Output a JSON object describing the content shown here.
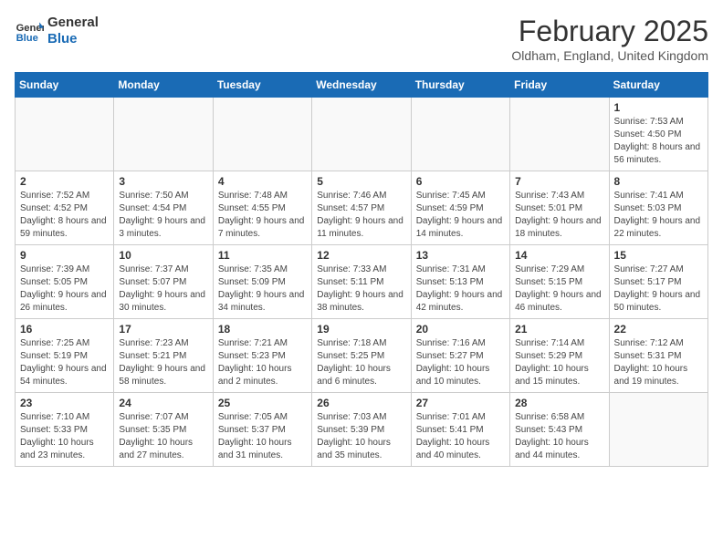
{
  "logo": {
    "line1": "General",
    "line2": "Blue"
  },
  "title": "February 2025",
  "location": "Oldham, England, United Kingdom",
  "weekdays": [
    "Sunday",
    "Monday",
    "Tuesday",
    "Wednesday",
    "Thursday",
    "Friday",
    "Saturday"
  ],
  "weeks": [
    [
      {
        "day": "",
        "info": ""
      },
      {
        "day": "",
        "info": ""
      },
      {
        "day": "",
        "info": ""
      },
      {
        "day": "",
        "info": ""
      },
      {
        "day": "",
        "info": ""
      },
      {
        "day": "",
        "info": ""
      },
      {
        "day": "1",
        "info": "Sunrise: 7:53 AM\nSunset: 4:50 PM\nDaylight: 8 hours and 56 minutes."
      }
    ],
    [
      {
        "day": "2",
        "info": "Sunrise: 7:52 AM\nSunset: 4:52 PM\nDaylight: 8 hours and 59 minutes."
      },
      {
        "day": "3",
        "info": "Sunrise: 7:50 AM\nSunset: 4:54 PM\nDaylight: 9 hours and 3 minutes."
      },
      {
        "day": "4",
        "info": "Sunrise: 7:48 AM\nSunset: 4:55 PM\nDaylight: 9 hours and 7 minutes."
      },
      {
        "day": "5",
        "info": "Sunrise: 7:46 AM\nSunset: 4:57 PM\nDaylight: 9 hours and 11 minutes."
      },
      {
        "day": "6",
        "info": "Sunrise: 7:45 AM\nSunset: 4:59 PM\nDaylight: 9 hours and 14 minutes."
      },
      {
        "day": "7",
        "info": "Sunrise: 7:43 AM\nSunset: 5:01 PM\nDaylight: 9 hours and 18 minutes."
      },
      {
        "day": "8",
        "info": "Sunrise: 7:41 AM\nSunset: 5:03 PM\nDaylight: 9 hours and 22 minutes."
      }
    ],
    [
      {
        "day": "9",
        "info": "Sunrise: 7:39 AM\nSunset: 5:05 PM\nDaylight: 9 hours and 26 minutes."
      },
      {
        "day": "10",
        "info": "Sunrise: 7:37 AM\nSunset: 5:07 PM\nDaylight: 9 hours and 30 minutes."
      },
      {
        "day": "11",
        "info": "Sunrise: 7:35 AM\nSunset: 5:09 PM\nDaylight: 9 hours and 34 minutes."
      },
      {
        "day": "12",
        "info": "Sunrise: 7:33 AM\nSunset: 5:11 PM\nDaylight: 9 hours and 38 minutes."
      },
      {
        "day": "13",
        "info": "Sunrise: 7:31 AM\nSunset: 5:13 PM\nDaylight: 9 hours and 42 minutes."
      },
      {
        "day": "14",
        "info": "Sunrise: 7:29 AM\nSunset: 5:15 PM\nDaylight: 9 hours and 46 minutes."
      },
      {
        "day": "15",
        "info": "Sunrise: 7:27 AM\nSunset: 5:17 PM\nDaylight: 9 hours and 50 minutes."
      }
    ],
    [
      {
        "day": "16",
        "info": "Sunrise: 7:25 AM\nSunset: 5:19 PM\nDaylight: 9 hours and 54 minutes."
      },
      {
        "day": "17",
        "info": "Sunrise: 7:23 AM\nSunset: 5:21 PM\nDaylight: 9 hours and 58 minutes."
      },
      {
        "day": "18",
        "info": "Sunrise: 7:21 AM\nSunset: 5:23 PM\nDaylight: 10 hours and 2 minutes."
      },
      {
        "day": "19",
        "info": "Sunrise: 7:18 AM\nSunset: 5:25 PM\nDaylight: 10 hours and 6 minutes."
      },
      {
        "day": "20",
        "info": "Sunrise: 7:16 AM\nSunset: 5:27 PM\nDaylight: 10 hours and 10 minutes."
      },
      {
        "day": "21",
        "info": "Sunrise: 7:14 AM\nSunset: 5:29 PM\nDaylight: 10 hours and 15 minutes."
      },
      {
        "day": "22",
        "info": "Sunrise: 7:12 AM\nSunset: 5:31 PM\nDaylight: 10 hours and 19 minutes."
      }
    ],
    [
      {
        "day": "23",
        "info": "Sunrise: 7:10 AM\nSunset: 5:33 PM\nDaylight: 10 hours and 23 minutes."
      },
      {
        "day": "24",
        "info": "Sunrise: 7:07 AM\nSunset: 5:35 PM\nDaylight: 10 hours and 27 minutes."
      },
      {
        "day": "25",
        "info": "Sunrise: 7:05 AM\nSunset: 5:37 PM\nDaylight: 10 hours and 31 minutes."
      },
      {
        "day": "26",
        "info": "Sunrise: 7:03 AM\nSunset: 5:39 PM\nDaylight: 10 hours and 35 minutes."
      },
      {
        "day": "27",
        "info": "Sunrise: 7:01 AM\nSunset: 5:41 PM\nDaylight: 10 hours and 40 minutes."
      },
      {
        "day": "28",
        "info": "Sunrise: 6:58 AM\nSunset: 5:43 PM\nDaylight: 10 hours and 44 minutes."
      },
      {
        "day": "",
        "info": ""
      }
    ]
  ]
}
